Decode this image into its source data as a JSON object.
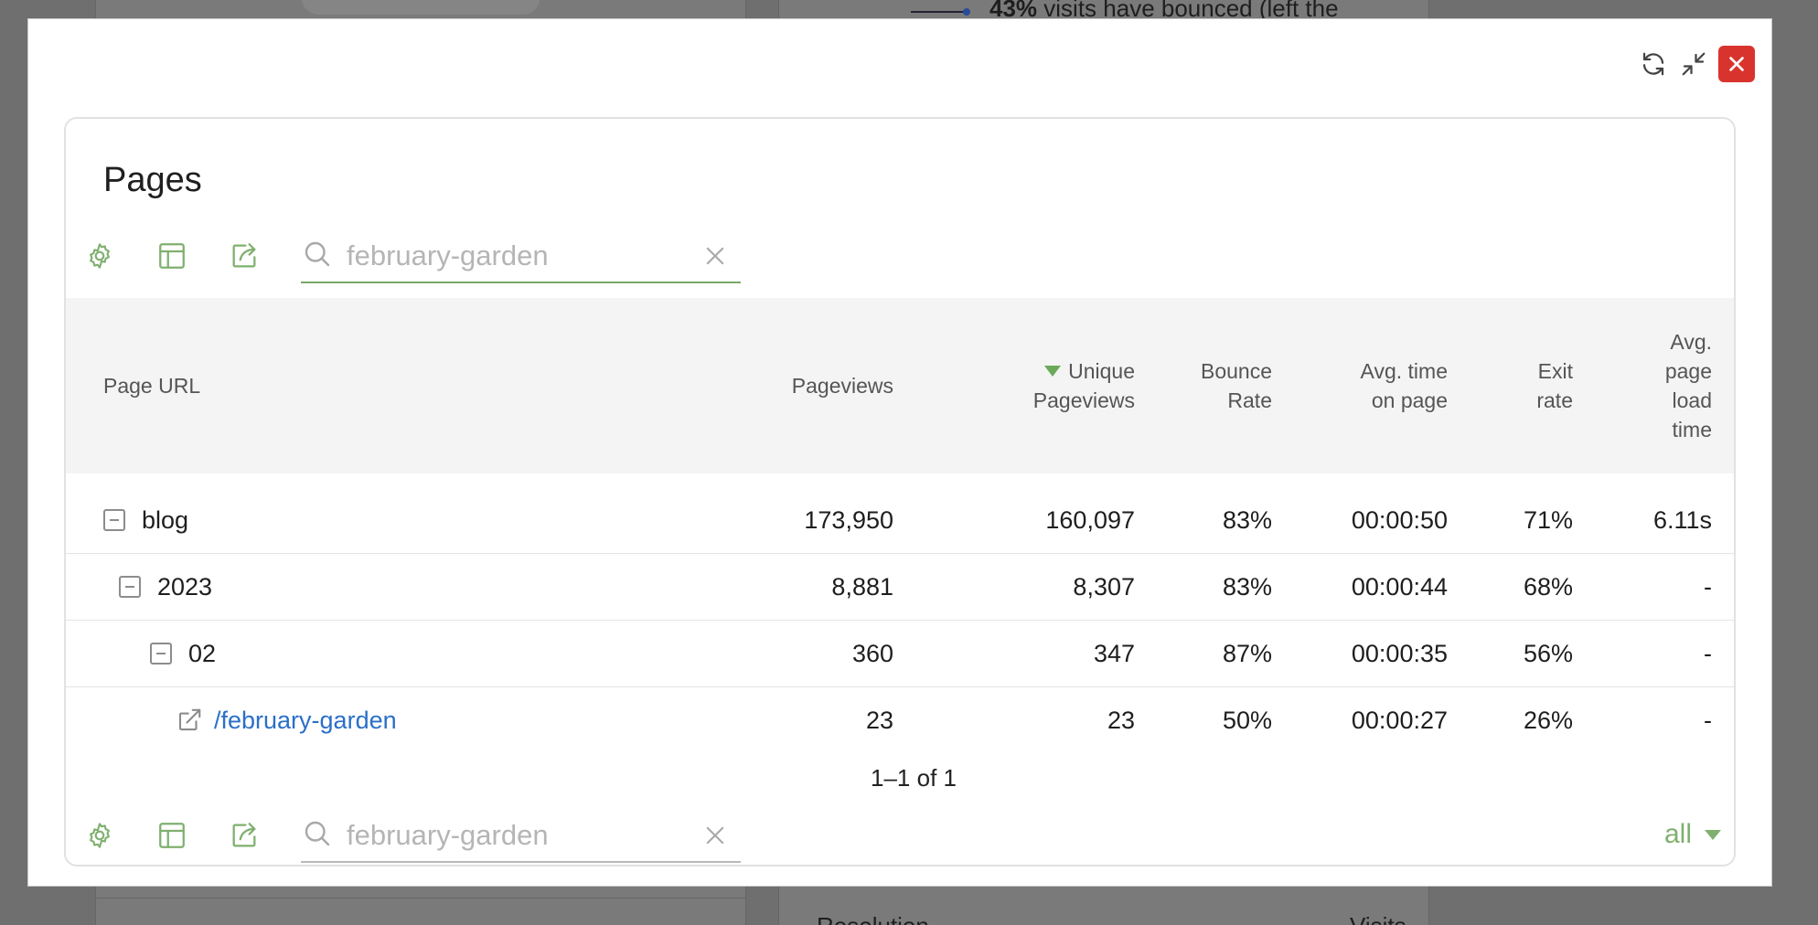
{
  "background": {
    "bounce_text_bold": "43%",
    "bounce_text": "visits have bounced (left the",
    "bottom_left_text": "Resolution",
    "bottom_right_text": "Visits"
  },
  "modal": {
    "actions": {
      "refresh_icon": "refresh-icon",
      "collapse_icon": "collapse-icon",
      "close_icon": "close-icon",
      "close_color": "#d9332d"
    },
    "title": "Pages",
    "search": {
      "value": "",
      "placeholder": "february-garden"
    },
    "columns": [
      {
        "key": "label",
        "label": "Page URL"
      },
      {
        "key": "pageviews",
        "label": "Pageviews"
      },
      {
        "key": "unique_pageviews",
        "label": "Unique Pageviews",
        "sorted": "desc"
      },
      {
        "key": "bounce_rate",
        "label": "Bounce Rate"
      },
      {
        "key": "avg_time",
        "label": "Avg. time on page"
      },
      {
        "key": "exit_rate",
        "label": "Exit rate"
      },
      {
        "key": "avg_load",
        "label": "Avg. page load time"
      }
    ],
    "header_lines": {
      "label": [
        "Page URL"
      ],
      "pageviews": [
        "Pageviews"
      ],
      "unique_pageviews": [
        "Unique",
        "Pageviews"
      ],
      "bounce_rate": [
        "Bounce",
        "Rate"
      ],
      "avg_time": [
        "Avg. time",
        "on page"
      ],
      "exit_rate": [
        "Exit",
        "rate"
      ],
      "avg_load": [
        "Avg.",
        "page",
        "load",
        "time"
      ]
    },
    "rows": [
      {
        "label": "blog",
        "type": "folder",
        "level": 0,
        "pageviews": "173,950",
        "unique_pageviews": "160,097",
        "bounce_rate": "83%",
        "avg_time": "00:00:50",
        "exit_rate": "71%",
        "avg_load": "6.11s"
      },
      {
        "label": "2023",
        "type": "folder",
        "level": 1,
        "pageviews": "8,881",
        "unique_pageviews": "8,307",
        "bounce_rate": "83%",
        "avg_time": "00:00:44",
        "exit_rate": "68%",
        "avg_load": "-"
      },
      {
        "label": "02",
        "type": "folder",
        "level": 2,
        "pageviews": "360",
        "unique_pageviews": "347",
        "bounce_rate": "87%",
        "avg_time": "00:00:35",
        "exit_rate": "56%",
        "avg_load": "-"
      },
      {
        "label": "/february-garden",
        "type": "link",
        "level": 3,
        "pageviews": "23",
        "unique_pageviews": "23",
        "bounce_rate": "50%",
        "avg_time": "00:00:27",
        "exit_rate": "26%",
        "avg_load": "-"
      }
    ],
    "pagination": "1–1 of 1",
    "limit": "all",
    "accent_color": "#7fb06f",
    "link_color": "#2b6fc7"
  }
}
